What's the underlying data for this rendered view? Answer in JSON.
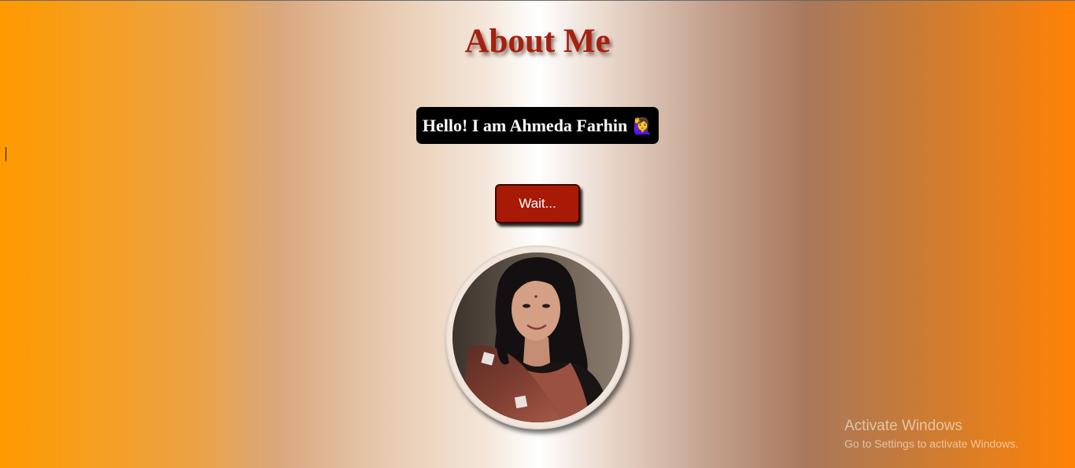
{
  "page": {
    "title": "About Me",
    "greeting": "Hello! I am Ahmeda Farhin",
    "greeting_emoji": "🙋‍♀️",
    "wait_button_label": "Wait...",
    "profile_photo_alt": "Portrait of Ahmeda Farhin"
  },
  "os_watermark": {
    "title": "Activate Windows",
    "subtitle": "Go to Settings to activate Windows."
  },
  "colors": {
    "title": "#a4200f",
    "button_bg": "#a81a06",
    "greeting_bg": "#000000",
    "gradient_left": "#ff9a00",
    "gradient_center": "#ffffff",
    "gradient_right": "#ff8205"
  }
}
